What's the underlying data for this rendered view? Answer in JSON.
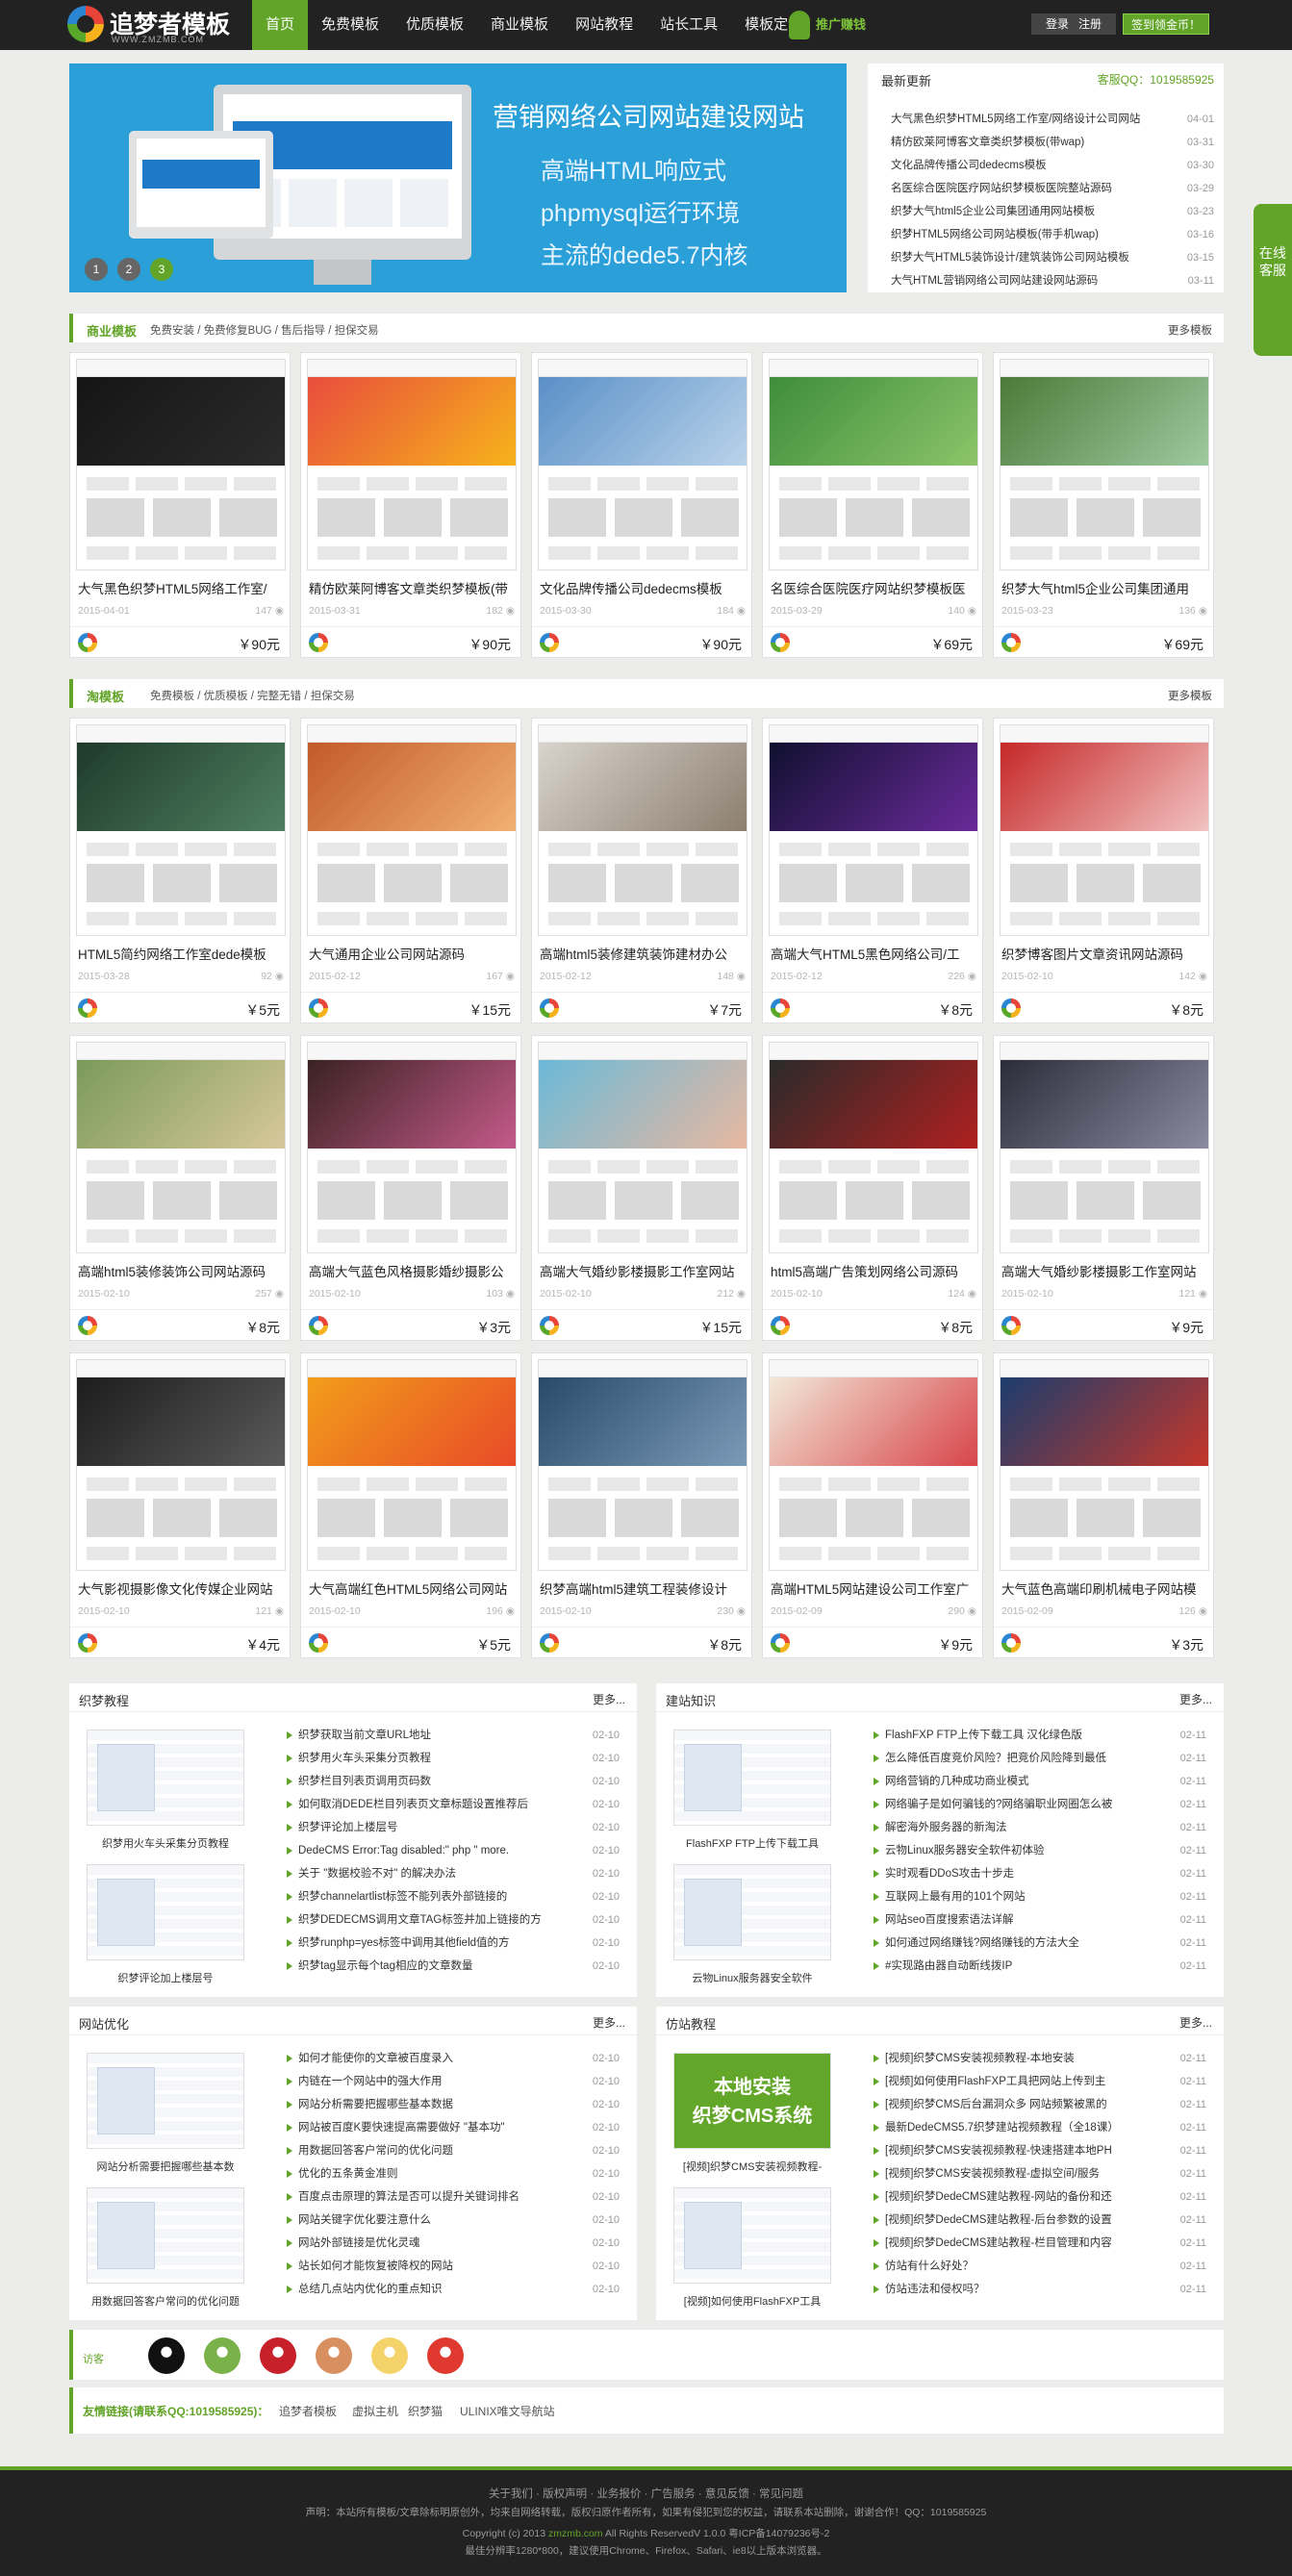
{
  "header": {
    "logo_title": "追梦者模板",
    "logo_sub": "WWW.ZMZMB.COM",
    "nav": [
      "首页",
      "免费模板",
      "优质模板",
      "商业模板",
      "网站教程",
      "站长工具",
      "模板定制"
    ],
    "promo": "推广赚钱",
    "login": "登录",
    "register": "注册",
    "sign": "签到领金币！"
  },
  "banner": {
    "title": "营销网络公司网站建设网站",
    "lines": [
      "高端HTML响应式",
      "phpmysql运行环境",
      "主流的dede5.7内核"
    ],
    "dots": [
      "1",
      "2",
      "3"
    ]
  },
  "news": {
    "title": "最新更新",
    "qq": "客服QQ：1019585925",
    "items": [
      {
        "t": "大气黑色织梦HTML5网络工作室/网络设计公司网站",
        "d": "04-01"
      },
      {
        "t": "精仿欧莱阿博客文章类织梦模板(带wap)",
        "d": "03-31"
      },
      {
        "t": "文化品牌传播公司dedecms模板",
        "d": "03-30"
      },
      {
        "t": "名医综合医院医疗网站织梦模板医院整站源码",
        "d": "03-29"
      },
      {
        "t": "织梦大气html5企业公司集团通用网站模板",
        "d": "03-23"
      },
      {
        "t": "织梦HTML5网络公司网站模板(带手机wap)",
        "d": "03-16"
      },
      {
        "t": "织梦大气HTML5装饰设计/建筑装饰公司网站模板",
        "d": "03-15"
      },
      {
        "t": "大气HTML营销网络公司网站建设网站源码",
        "d": "03-11"
      }
    ]
  },
  "service": "在线客服",
  "sections": {
    "biz": {
      "title": "商业模板",
      "sub": "免费安装 / 免费修复BUG / 售后指导 / 担保交易",
      "more": "更多模板"
    },
    "tao": {
      "title": "淘模板",
      "sub": "免费模板 / 优质模板 / 完整无错 / 担保交易",
      "more": "更多模板"
    }
  },
  "cards": [
    {
      "title": "大气黑色织梦HTML5网络工作室/",
      "date": "2015-04-01",
      "views": "147",
      "price": "￥90元",
      "c1": "#151515",
      "c2": "#2b2b2b"
    },
    {
      "title": "精仿欧莱阿博客文章类织梦模板(带",
      "date": "2015-03-31",
      "views": "182",
      "price": "￥90元",
      "c1": "#e94d3d",
      "c2": "#f6b21b"
    },
    {
      "title": "文化品牌传播公司dedecms模板",
      "date": "2015-03-30",
      "views": "184",
      "price": "￥90元",
      "c1": "#5a8fc7",
      "c2": "#b9d3ea"
    },
    {
      "title": "名医综合医院医疗网站织梦模板医",
      "date": "2015-03-29",
      "views": "140",
      "price": "￥69元",
      "c1": "#3e8d3a",
      "c2": "#8cc46a"
    },
    {
      "title": "织梦大气html5企业公司集团通用",
      "date": "2015-03-23",
      "views": "136",
      "price": "￥69元",
      "c1": "#4c7a38",
      "c2": "#9fc9a0"
    },
    {
      "title": "HTML5简约网络工作室dede模板",
      "date": "2015-03-28",
      "views": "92",
      "price": "￥5元",
      "c1": "#1f3a2a",
      "c2": "#4e7f60"
    },
    {
      "title": "大气通用企业公司网站源码",
      "date": "2015-02-12",
      "views": "167",
      "price": "￥15元",
      "c1": "#c35a2a",
      "c2": "#f0b070"
    },
    {
      "title": "高端html5装修建筑装饰建材办公",
      "date": "2015-02-12",
      "views": "148",
      "price": "￥7元",
      "c1": "#d8d3cc",
      "c2": "#8c7f70"
    },
    {
      "title": "高端大气HTML5黑色网络公司/工",
      "date": "2015-02-12",
      "views": "226",
      "price": "￥8元",
      "c1": "#101030",
      "c2": "#6a2a9a"
    },
    {
      "title": "织梦博客图片文章资讯网站源码",
      "date": "2015-02-10",
      "views": "142",
      "price": "￥8元",
      "c1": "#c62828",
      "c2": "#f2c2c2"
    },
    {
      "title": "高端html5装修装饰公司网站源码",
      "date": "2015-02-10",
      "views": "257",
      "price": "￥8元",
      "c1": "#7a9a5a",
      "c2": "#d7c79a"
    },
    {
      "title": "高端大气蓝色风格摄影婚纱摄影公",
      "date": "2015-02-10",
      "views": "103",
      "price": "￥3元",
      "c1": "#3a2222",
      "c2": "#c45a8a"
    },
    {
      "title": "高端大气婚纱影楼摄影工作室网站",
      "date": "2015-02-10",
      "views": "212",
      "price": "￥15元",
      "c1": "#6ab9d8",
      "c2": "#e8b8a0"
    },
    {
      "title": "html5高端广告策划网络公司源码",
      "date": "2015-02-10",
      "views": "124",
      "price": "￥8元",
      "c1": "#2a2a2a",
      "c2": "#b02020"
    },
    {
      "title": "高端大气婚纱影楼摄影工作室网站",
      "date": "2015-02-10",
      "views": "121",
      "price": "￥9元",
      "c1": "#2c2c3a",
      "c2": "#8a8aa0"
    },
    {
      "title": "大气影视摄影像文化传媒企业网站",
      "date": "2015-02-10",
      "views": "121",
      "price": "￥4元",
      "c1": "#1c1c1c",
      "c2": "#5a5a5a"
    },
    {
      "title": "大气高端红色HTML5网络公司网站",
      "date": "2015-02-10",
      "views": "196",
      "price": "￥5元",
      "c1": "#f29d1a",
      "c2": "#e84a28"
    },
    {
      "title": "织梦高端html5建筑工程装修设计",
      "date": "2015-02-10",
      "views": "230",
      "price": "￥8元",
      "c1": "#2a4a6a",
      "c2": "#7a9ab8"
    },
    {
      "title": "高端HTML5网站建设公司工作室广",
      "date": "2015-02-09",
      "views": "290",
      "price": "￥9元",
      "c1": "#f2e8d8",
      "c2": "#d8454a"
    },
    {
      "title": "大气蓝色高端印刷机械电子网站模",
      "date": "2015-02-09",
      "views": "126",
      "price": "￥3元",
      "c1": "#1b3d6d",
      "c2": "#c4362a"
    }
  ],
  "boxes": [
    {
      "title": "织梦教程",
      "more": "更多...",
      "pics": [
        "织梦用火车头采集分页教程",
        "织梦评论加上楼层号"
      ],
      "items": [
        {
          "t": "织梦获取当前文章URL地址",
          "d": "02-10"
        },
        {
          "t": "织梦用火车头采集分页教程",
          "d": "02-10"
        },
        {
          "t": "织梦栏目列表页调用页码数",
          "d": "02-10"
        },
        {
          "t": "如何取消DEDE栏目列表页文章标题设置推荐后",
          "d": "02-10"
        },
        {
          "t": "织梦评论加上楼层号",
          "d": "02-10"
        },
        {
          "t": "DedeCMS Error:Tag disabled:\" php \" more.",
          "d": "02-10"
        },
        {
          "t": "关于 \"数据校验不对\" 的解决办法",
          "d": "02-10"
        },
        {
          "t": "织梦channelartlist标签不能列表外部链接的",
          "d": "02-10"
        },
        {
          "t": "织梦DEDECMS调用文章TAG标签并加上链接的方",
          "d": "02-10"
        },
        {
          "t": "织梦runphp=yes标签中调用其他field值的方",
          "d": "02-10"
        },
        {
          "t": "织梦tag显示每个tag相应的文章数量",
          "d": "02-10"
        }
      ]
    },
    {
      "title": "建站知识",
      "more": "更多...",
      "pics": [
        "FlashFXP FTP上传下载工具",
        "云物Linux服务器安全软件"
      ],
      "items": [
        {
          "t": "FlashFXP FTP上传下载工具 汉化绿色版",
          "d": "02-11"
        },
        {
          "t": "怎么降低百度竞价风险？把竞价风险降到最低",
          "d": "02-11"
        },
        {
          "t": "网络营销的几种成功商业模式",
          "d": "02-11"
        },
        {
          "t": "网络骗子是如何骗钱的?网络骗职业网圈怎么被",
          "d": "02-11"
        },
        {
          "t": "解密海外服务器的新淘法",
          "d": "02-11"
        },
        {
          "t": "云物Linux服务器安全软件初体验",
          "d": "02-11"
        },
        {
          "t": "实时观看DDoS攻击十步走",
          "d": "02-11"
        },
        {
          "t": "互联网上最有用的101个网站",
          "d": "02-11"
        },
        {
          "t": "网站seo百度搜索语法详解",
          "d": "02-11"
        },
        {
          "t": "如何通过网络赚钱?网络赚钱的方法大全",
          "d": "02-11"
        },
        {
          "t": "#实现路由器自动断线拨IP",
          "d": "02-11"
        }
      ]
    },
    {
      "title": "网站优化",
      "more": "更多...",
      "pics": [
        "网站分析需要把握哪些基本数",
        "用数据回答客户常问的优化问题"
      ],
      "items": [
        {
          "t": "如何才能使你的文章被百度录入",
          "d": "02-10"
        },
        {
          "t": "内链在一个网站中的强大作用",
          "d": "02-10"
        },
        {
          "t": "网站分析需要把握哪些基本数据",
          "d": "02-10"
        },
        {
          "t": "网站被百度K要快速提高需要做好 \"基本功\"",
          "d": "02-10"
        },
        {
          "t": "用数据回答客户常问的优化问题",
          "d": "02-10"
        },
        {
          "t": "优化的五条黄金准则",
          "d": "02-10"
        },
        {
          "t": "百度点击原理的算法是否可以提升关键词排名",
          "d": "02-10"
        },
        {
          "t": "网站关键字优化要注意什么",
          "d": "02-10"
        },
        {
          "t": "网站外部链接是优化灵魂",
          "d": "02-10"
        },
        {
          "t": "站长如何才能恢复被降权的网站",
          "d": "02-10"
        },
        {
          "t": "总结几点站内优化的重点知识",
          "d": "02-10"
        }
      ]
    },
    {
      "title": "仿站教程",
      "more": "更多...",
      "pics": [
        "[视频]织梦CMS安装视频教程-",
        "[视频]如何使用FlashFXP工具"
      ],
      "pic_banner": [
        "本地安装",
        "织梦CMS系统"
      ],
      "items": [
        {
          "t": "[视频]织梦CMS安装视频教程-本地安装",
          "d": "02-11"
        },
        {
          "t": "[视频]如何使用FlashFXP工具把网站上传到主",
          "d": "02-11"
        },
        {
          "t": "[视频]织梦CMS后台漏洞众多 网站频繁被黑的",
          "d": "02-11"
        },
        {
          "t": "最新DedeCMS5.7织梦建站视频教程（全18课）",
          "d": "02-11"
        },
        {
          "t": "[视频]织梦CMS安装视频教程-快速搭建本地PH",
          "d": "02-11"
        },
        {
          "t": "[视频]织梦CMS安装视频教程-虚拟空间/服务",
          "d": "02-11"
        },
        {
          "t": "[视频]织梦DedeCMS建站教程-网站的备份和还",
          "d": "02-11"
        },
        {
          "t": "[视频]织梦DedeCMS建站教程-后台参数的设置",
          "d": "02-11"
        },
        {
          "t": "[视频]织梦DedeCMS建站教程-栏目管理和内容",
          "d": "02-11"
        },
        {
          "t": "仿站有什么好处？",
          "d": "02-11"
        },
        {
          "t": "仿站违法和侵权吗？",
          "d": "02-11"
        }
      ]
    }
  ],
  "visitors": {
    "label": "访客",
    "colors": [
      "#111111",
      "#7ab24a",
      "#c8202a",
      "#d89060",
      "#f4d36a",
      "#e03a30"
    ]
  },
  "friend": {
    "label": "友情链接(请联系QQ:1019585925)：",
    "links": [
      "追梦者模板",
      "虚拟主机",
      "织梦猫",
      "ULINIX唯文导航站"
    ]
  },
  "footer": {
    "links": "关于我们 · 版权声明 · 业务报价 · 广告服务 · 意见反馈 · 常见问题",
    "notice": "声明：本站所有模板/文章除标明原创外，均来自网络转载，版权归原作者所有，如果有侵犯到您的权益，请联系本站删除，谢谢合作！QQ：1019585925",
    "copy_pre": "Copyright (c) 2013",
    "copy_site": "zmzmb.com",
    "copy_post": "All Rights ReservedV 1.0.0   粤ICP备14079236号-2",
    "tip": "最佳分辨率1280*800，建议使用Chrome、Firefox、Safari、ie8以上版本浏览器。"
  }
}
